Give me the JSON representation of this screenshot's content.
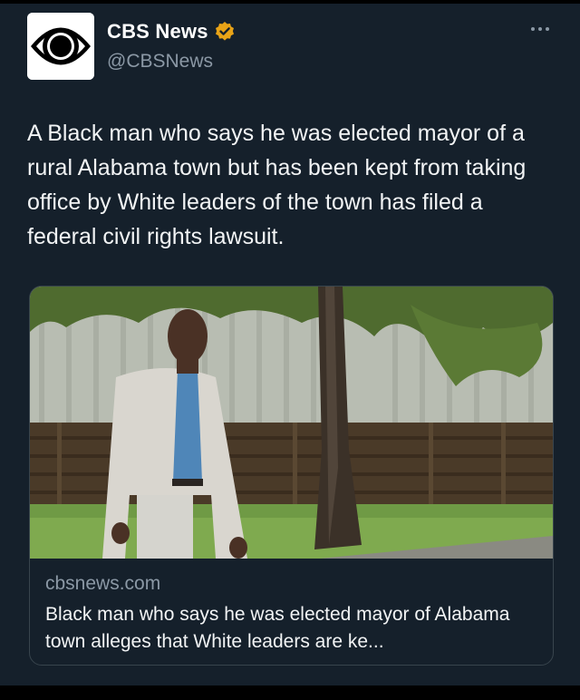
{
  "author": {
    "display_name": "CBS News",
    "handle": "@CBSNews",
    "verified": true,
    "verified_color": "#e8a317",
    "avatar_icon": "cbs-eye-logo-icon"
  },
  "more_icon": "more-options-icon",
  "tweet": {
    "text": "A Black man who says he was elected mayor of a rural Alabama town but has been kept from taking office by White leaders of the town has filed a federal civil rights lawsuit."
  },
  "link_card": {
    "domain": "cbsnews.com",
    "title": "Black man who says he was elected mayor of Alabama town alleges that White leaders are ke..."
  },
  "colors": {
    "background": "#15202b",
    "text_secondary": "#8b98a5",
    "border": "#38444d"
  }
}
